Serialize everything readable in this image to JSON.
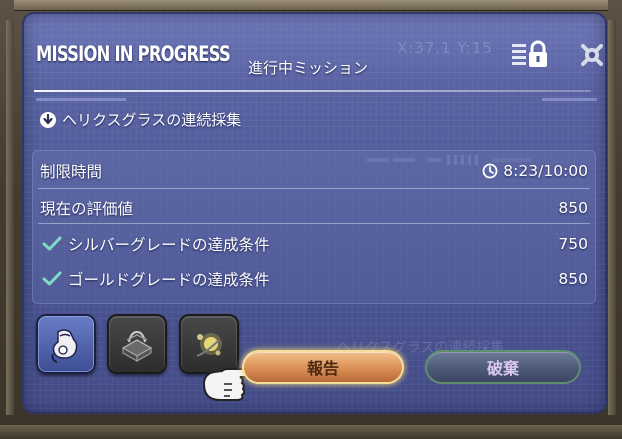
{
  "header": {
    "title": "MISSION IN PROGRESS",
    "subtitle": "進行中ミッション",
    "coordinates": "X:37.1 Y:15"
  },
  "mission": {
    "name": "ヘリクスグラスの連続採集"
  },
  "info": {
    "time_limit_label": "制限時間",
    "time_limit_value": "8:23/10:00",
    "score_label": "現在の評価値",
    "score_value": "850",
    "silver_label": "シルバーグレードの達成条件",
    "silver_value": "750",
    "gold_label": "ゴールドグレードの達成条件",
    "gold_value": "850"
  },
  "actions": {
    "report_label": "報告",
    "abandon_label": "破棄"
  },
  "ghost_text": "ヘリクスグラスの連続採集",
  "tools": [
    {
      "icon": "gathering-glove-icon",
      "active": true
    },
    {
      "icon": "collectable-basket-icon",
      "active": false
    },
    {
      "icon": "sparkle-skill-icon",
      "active": false
    }
  ],
  "colors": {
    "panel": "#4d5796",
    "report_button": "#d98f55",
    "abandon_button": "#4d5a78",
    "check": "#7fdcc4"
  }
}
